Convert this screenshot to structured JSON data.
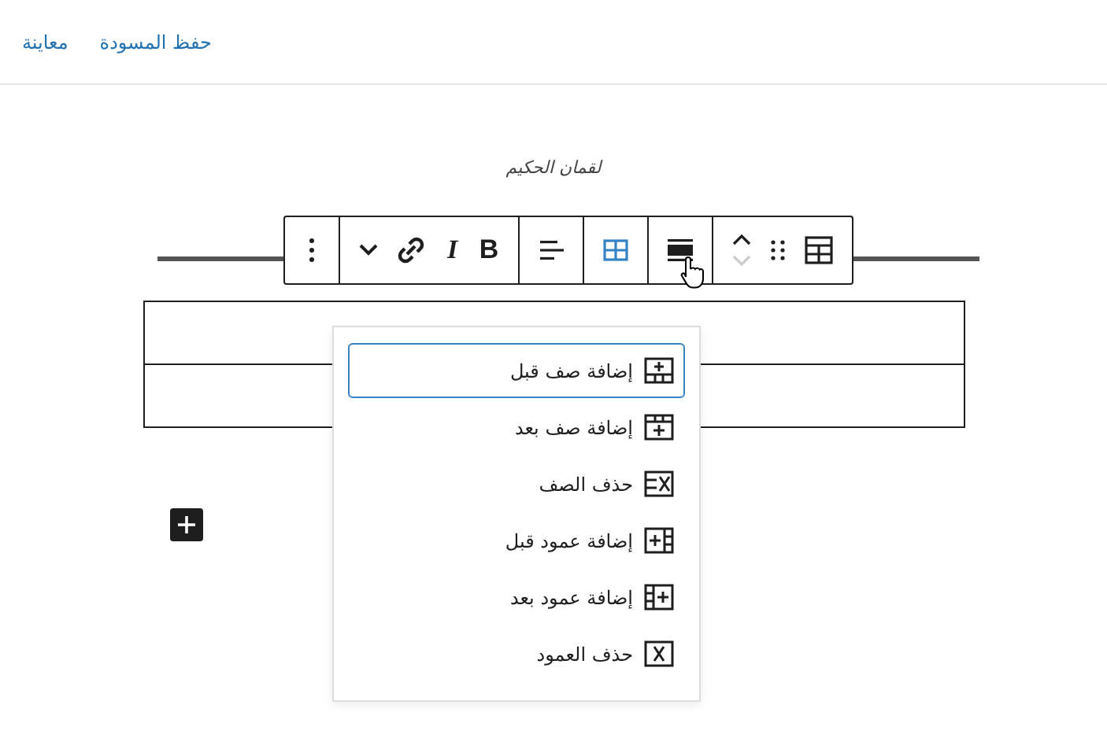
{
  "header": {
    "links": [
      {
        "label": "حفظ المسودة"
      },
      {
        "label": "معاينة"
      }
    ]
  },
  "quote": {
    "citation": "لقمان الحكيم"
  },
  "toolbar": {
    "groups": [
      [
        {
          "kind": "table"
        },
        {
          "kind": "drag"
        },
        {
          "kind": "mover"
        }
      ],
      [
        {
          "kind": "full-width"
        }
      ],
      [
        {
          "kind": "table-edit",
          "selected": true
        }
      ],
      [
        {
          "kind": "align"
        }
      ],
      [
        {
          "kind": "bold",
          "label": "B"
        },
        {
          "kind": "italic",
          "label": "I"
        },
        {
          "kind": "link"
        },
        {
          "kind": "chevron"
        }
      ],
      [
        {
          "kind": "more"
        }
      ]
    ]
  },
  "menu": {
    "items": [
      {
        "label": "إضافة صف قبل",
        "kind": "row-before",
        "selected": true
      },
      {
        "label": "إضافة صف بعد",
        "kind": "row-after",
        "selected": false
      },
      {
        "label": "حذف الصف",
        "kind": "row-delete",
        "selected": false
      },
      {
        "label": "إضافة عمود قبل",
        "kind": "col-before",
        "selected": false
      },
      {
        "label": "إضافة عمود بعد",
        "kind": "col-after",
        "selected": false
      },
      {
        "label": "حذف العمود",
        "kind": "col-delete",
        "selected": false
      }
    ]
  }
}
